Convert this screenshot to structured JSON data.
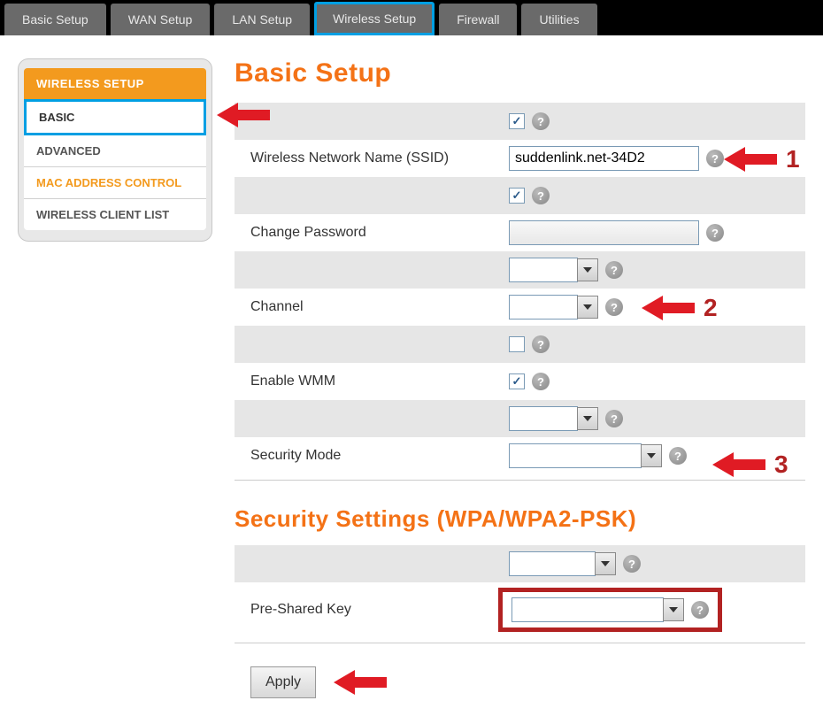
{
  "nav": {
    "tabs": [
      {
        "label": "Basic Setup",
        "active": false
      },
      {
        "label": "WAN Setup",
        "active": false
      },
      {
        "label": "LAN Setup",
        "active": false
      },
      {
        "label": "Wireless Setup",
        "active": true
      },
      {
        "label": "Firewall",
        "active": false
      },
      {
        "label": "Utilities",
        "active": false
      }
    ]
  },
  "sidebar": {
    "header": "WIRELESS SETUP",
    "items": [
      {
        "label": "BASIC",
        "active": true,
        "orange": false
      },
      {
        "label": "ADVANCED",
        "active": false,
        "orange": false
      },
      {
        "label": "MAC ADDRESS CONTROL",
        "active": false,
        "orange": true
      },
      {
        "label": "WIRELESS CLIENT LIST",
        "active": false,
        "orange": false
      }
    ]
  },
  "sections": {
    "basic_title": "Basic Setup",
    "security_title": "Security Settings (WPA/WPA2-PSK)"
  },
  "fields": {
    "ssid_label": "Wireless Network Name (SSID)",
    "ssid_value": "suddenlink.net-34D2",
    "change_password_label": "Change Password",
    "channel_label": "Channel",
    "enable_wmm_label": "Enable WMM",
    "security_mode_label": "Security Mode",
    "psk_label": "Pre-Shared Key"
  },
  "buttons": {
    "apply": "Apply"
  },
  "annotations": {
    "a1": "1",
    "a2": "2",
    "a3": "3"
  },
  "icons": {
    "help": "?"
  }
}
